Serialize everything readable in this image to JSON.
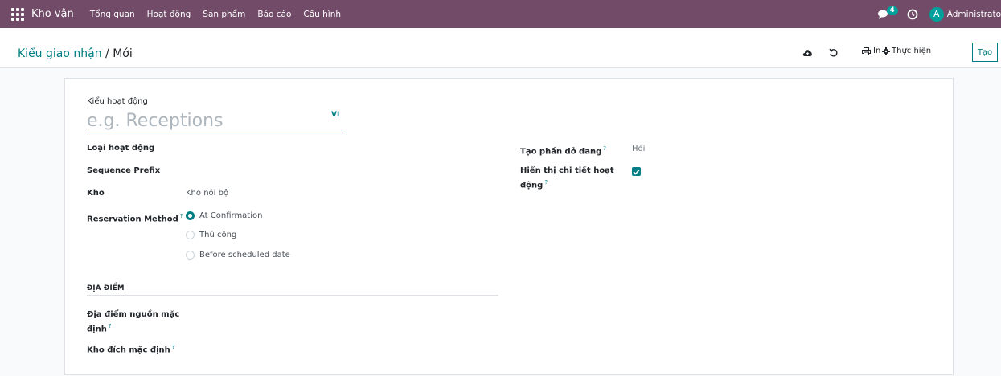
{
  "navbar": {
    "brand": "Kho vận",
    "menu": [
      "Tổng quan",
      "Hoạt động",
      "Sản phẩm",
      "Báo cáo",
      "Cấu hình"
    ],
    "message_count": "4",
    "user_initial": "A",
    "user_name": "Administrato"
  },
  "control": {
    "breadcrumb_parent": "Kiểu giao nhận",
    "breadcrumb_separator": " / ",
    "breadcrumb_current": "Mới",
    "print_label": "In",
    "action_label": "Thực hiện",
    "create_label": "Tạo"
  },
  "form": {
    "title_label": "Kiểu hoạt động",
    "name_placeholder": "e.g. Receptions",
    "lang": "VI",
    "operation_type_label": "Loại hoạt động",
    "sequence_prefix_label": "Sequence Prefix",
    "warehouse_label": "Kho",
    "warehouse_value": "Kho nội bộ",
    "reservation_label": "Reservation Method",
    "reservation_options": [
      "At Confirmation",
      "Thủ công",
      "Before scheduled date"
    ],
    "reservation_selected": "At Confirmation",
    "backorder_label": "Tạo phần dở dang",
    "backorder_value": "Hỏi",
    "show_operations_label_line1": "Hiển thị chi tiết hoạt",
    "show_operations_label_line2": "động",
    "show_operations_checked": true,
    "section_locations": "ĐỊA ĐIỂM",
    "default_src_label_line1": "Địa điểm nguồn mặc",
    "default_src_label_line2": "định",
    "default_dest_label": "Kho đích mặc định",
    "help_mark": "?"
  },
  "colors": {
    "navbar": "#714b67",
    "accent": "#017e84",
    "badge": "#00a09d"
  }
}
